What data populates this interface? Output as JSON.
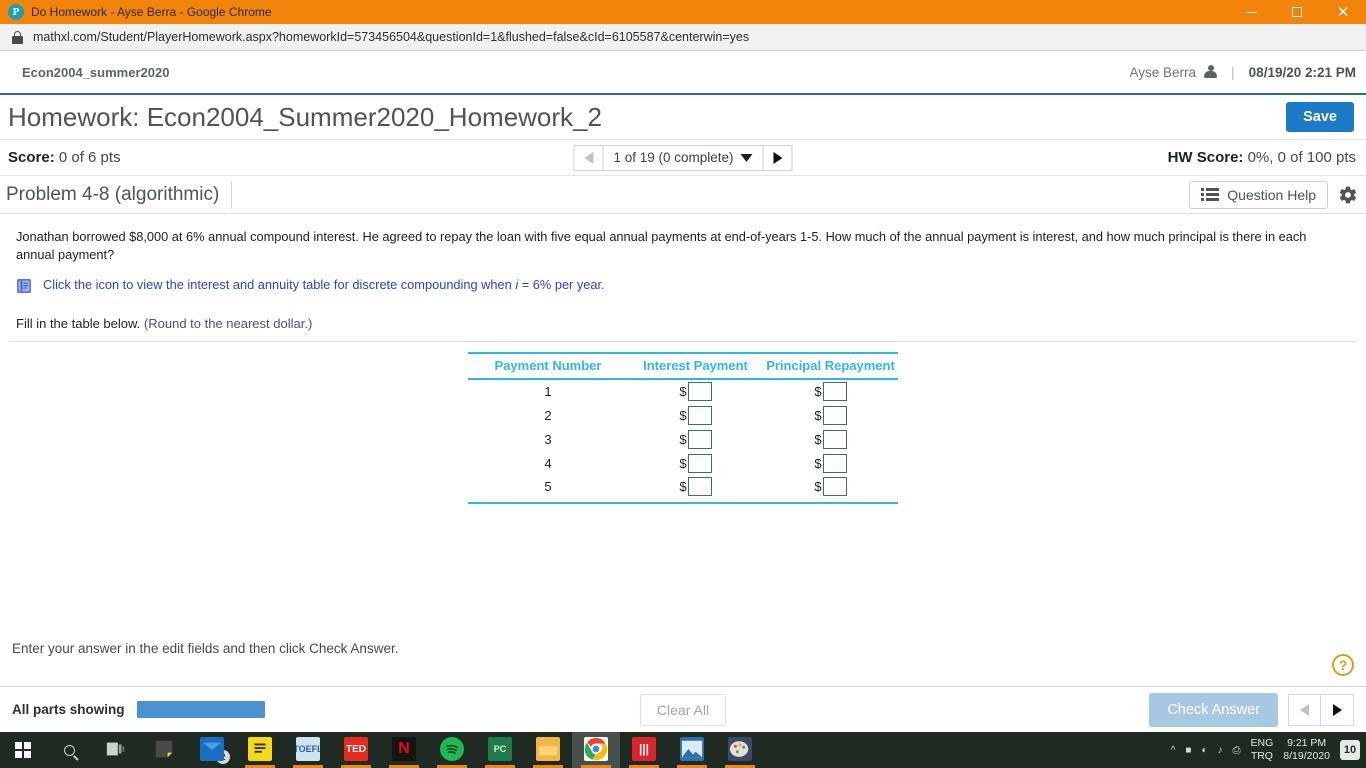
{
  "browser": {
    "window_title": "Do Homework - Ayse Berra - Google Chrome",
    "favicon_letter": "P",
    "url": "mathxl.com/Student/PlayerHomework.aspx?homeworkId=573456504&questionId=1&flushed=false&cId=6105587&centerwin=yes",
    "minimize_label": "Minimize",
    "maximize_label": "Maximize",
    "close_label": "Close"
  },
  "app_header": {
    "course_name": "Econ2004_summer2020",
    "user_name": "Ayse Berra",
    "separator": "|",
    "timestamp": "08/19/20 2:21 PM"
  },
  "homework": {
    "title": "Homework: Econ2004_Summer2020_Homework_2",
    "save_label": "Save"
  },
  "score_bar": {
    "score_label": "Score:",
    "score_value": "0 of 6 pts",
    "question_nav": "1 of 19 (0 complete)",
    "prev_label": "Previous question",
    "next_label": "Next question",
    "hw_score_label": "HW Score:",
    "hw_score_value": "0%, 0 of 100 pts"
  },
  "problem": {
    "title": "Problem 4-8 (algorithmic)",
    "question_help_label": "Question Help",
    "settings_label": "Settings",
    "question_text": "Jonathan borrowed $8,000 at 6% annual compound interest. He agreed to repay the loan with five equal annual payments at end-of-years 1-5. How much of the annual payment is interest, and how much principal is there in each annual payment?",
    "resource_link_part1": "Click the icon to view the interest and annuity table for discrete compounding when ",
    "resource_link_italic": "i",
    "resource_link_part2": " = 6% per year.",
    "fill_instruction": "Fill in the table below. ",
    "round_note": "(Round to the nearest dollar.)"
  },
  "answer_table": {
    "headers": [
      "Payment Number",
      "Interest Payment",
      "Principal Repayment"
    ],
    "currency_symbol": "$",
    "rows": [
      {
        "payment_number": "1",
        "interest_payment": "",
        "principal_repayment": ""
      },
      {
        "payment_number": "2",
        "interest_payment": "",
        "principal_repayment": ""
      },
      {
        "payment_number": "3",
        "interest_payment": "",
        "principal_repayment": ""
      },
      {
        "payment_number": "4",
        "interest_payment": "",
        "principal_repayment": ""
      },
      {
        "payment_number": "5",
        "interest_payment": "",
        "principal_repayment": ""
      }
    ]
  },
  "footer": {
    "instruction": "Enter your answer in the edit fields and then click Check Answer.",
    "help_glyph": "?",
    "parts_label": "All parts showing",
    "clear_all_label": "Clear All",
    "check_answer_label": "Check Answer",
    "prev_part_label": "Previous part",
    "next_part_label": "Next part"
  },
  "colors": {
    "accent_blue": "#1d7ac9",
    "table_cyan": "#2fb9e0",
    "header_rule": "#2b6c79",
    "titlebar_orange": "#f2840b",
    "link_blue": "#2b44c4"
  },
  "taskbar": {
    "start_label": "Start",
    "search_label": "Search",
    "apps": [
      {
        "name": "taskview",
        "label": "",
        "color": "#3a3f45"
      },
      {
        "name": "sticky-notes",
        "label": "",
        "color": "#4a4a4a"
      },
      {
        "name": "mail",
        "label": "",
        "color": "#1a6fc4",
        "badge": "2"
      },
      {
        "name": "notes-yellow",
        "label": "",
        "color": "#f5d916"
      },
      {
        "name": "toefl",
        "label": "TOEFL",
        "color": "#cfe4f2"
      },
      {
        "name": "ted",
        "label": "TED",
        "color": "#e62b1e"
      },
      {
        "name": "netflix",
        "label": "N",
        "color": "#141414"
      },
      {
        "name": "spotify",
        "label": "",
        "color": "#1db954"
      },
      {
        "name": "pc-app",
        "label": "PC",
        "color": "#1f7a4c"
      },
      {
        "name": "file-explorer",
        "label": "",
        "color": "#f2b843"
      },
      {
        "name": "chrome",
        "label": "",
        "color": "#ffffff",
        "active": true
      },
      {
        "name": "red-app",
        "label": "|||",
        "color": "#d8262c"
      },
      {
        "name": "photos",
        "label": "",
        "color": "#2f6fb0"
      },
      {
        "name": "paint",
        "label": "",
        "color": "#3b4a6b"
      }
    ],
    "tray": {
      "language": "ENG",
      "language_sub": "TRQ",
      "time": "9:21 PM",
      "date": "8/19/2020",
      "notification_count": "10"
    }
  }
}
